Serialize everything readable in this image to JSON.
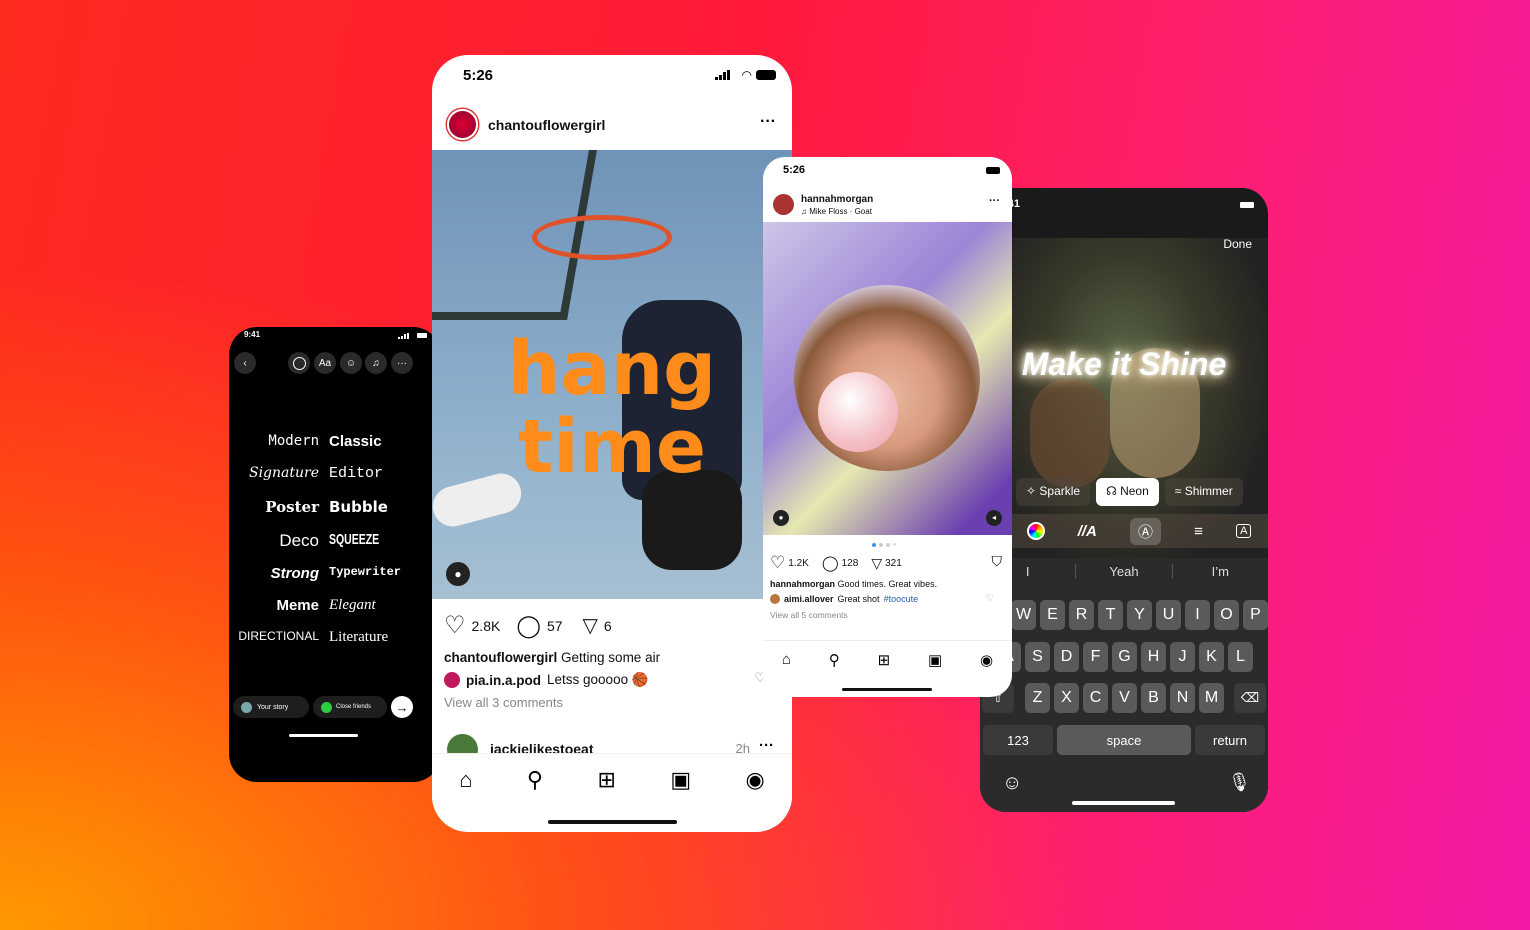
{
  "story_editor": {
    "time": "9:41",
    "tools": [
      "circle-icon",
      "Aa",
      "sticker-icon",
      "music-icon",
      "more-icon"
    ],
    "fonts": [
      [
        "Modern",
        "Classic"
      ],
      [
        "Signature",
        "Editor"
      ],
      [
        "Poster",
        "Bubble"
      ],
      [
        "Deco",
        "SQUEEZE"
      ],
      [
        "Strong",
        "Typewriter"
      ],
      [
        "Meme",
        "Elegant"
      ],
      [
        "DIRECTIONAL",
        "Literature"
      ]
    ],
    "your_story": "Your story",
    "close_friends": "Close friends"
  },
  "feed_post": {
    "time": "5:26",
    "username": "chantouflowergirl",
    "overlay_line1": "hang",
    "overlay_line2": "time",
    "overlay_color": "#ff8c1a",
    "likes": "2.8K",
    "comments": "57",
    "shares": "6",
    "caption_user": "chantouflowergirl",
    "caption_text": "Getting some air",
    "comment_user": "pia.in.a.pod",
    "comment_text": "Letss gooooo 🏀",
    "view_comments": "View all 3 comments",
    "next_user": "jackielikestoeat",
    "next_time": "2h"
  },
  "carousel_post": {
    "time": "5:26",
    "username": "hannahmorgan",
    "music": "Mike Floss · Goat",
    "likes": "1.2K",
    "comments": "128",
    "shares": "321",
    "caption_user": "hannahmorgan",
    "caption_text": "Good times. Great vibes.",
    "comment_user": "aimi.allover",
    "comment_text": "Great shot",
    "comment_tag": "#toocute",
    "hashtag_color": "#2a5db0",
    "view_comments": "View all 5 comments"
  },
  "text_effects": {
    "time": "9:41",
    "done": "Done",
    "text": "Make it Shine",
    "effects": [
      "Sparkle",
      "Neon",
      "Shimmer"
    ],
    "selected_effect": "Neon",
    "suggestions": [
      "I",
      "Yeah",
      "I’m"
    ],
    "rows": [
      [
        "Q",
        "W",
        "E",
        "R",
        "T",
        "Y",
        "U",
        "I",
        "O",
        "P"
      ],
      [
        "A",
        "S",
        "D",
        "F",
        "G",
        "H",
        "J",
        "K",
        "L"
      ],
      [
        "Z",
        "X",
        "C",
        "V",
        "B",
        "N",
        "M"
      ]
    ],
    "numbers": "123",
    "space": "space",
    "return": "return"
  }
}
